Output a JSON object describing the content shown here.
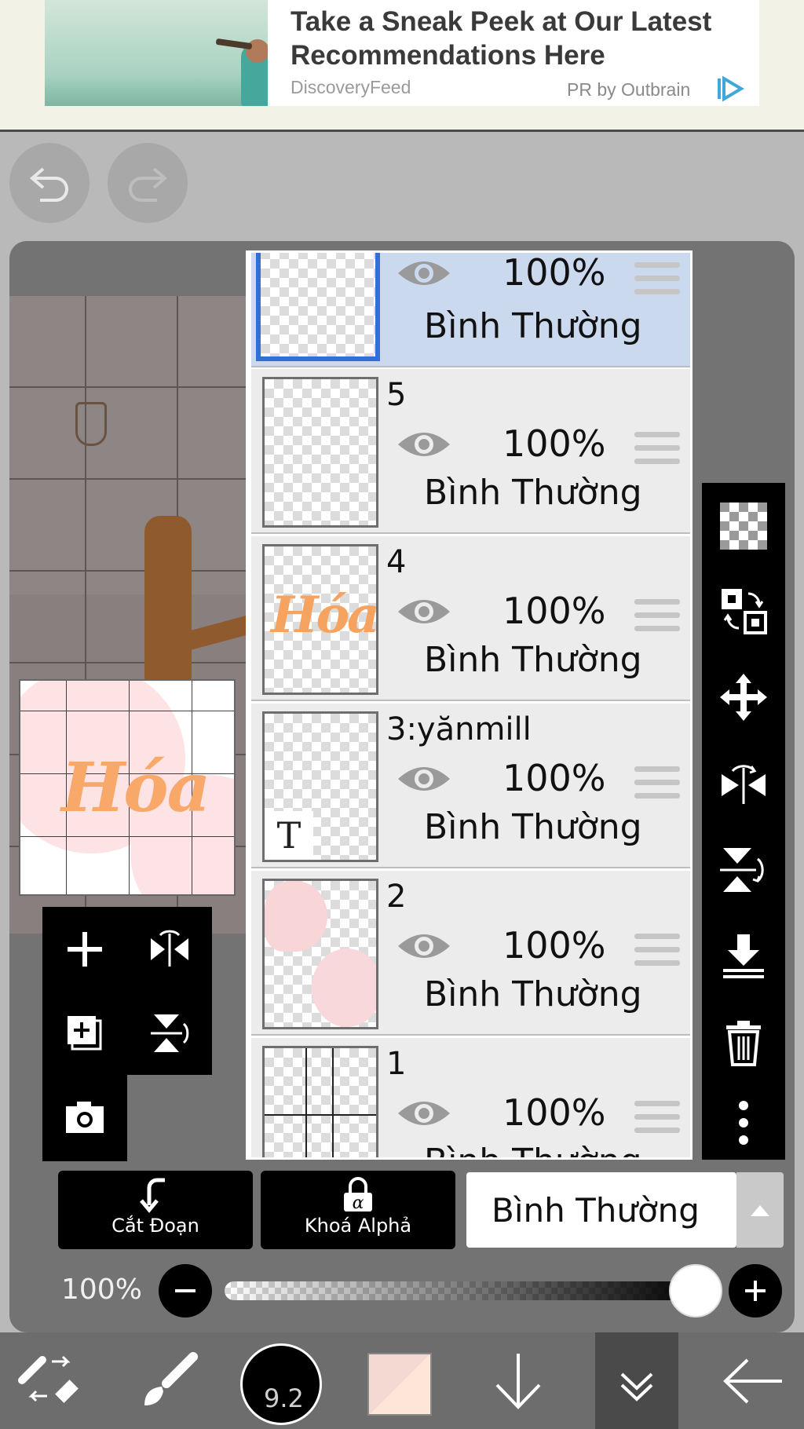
{
  "ad": {
    "title": "Take a Sneak Peek at Our Latest Recommendations Here",
    "source": "DiscoveryFeed",
    "pr": "PR by Outbrain"
  },
  "layers": [
    {
      "name": "",
      "opacity": "100%",
      "blend": "Bình Thường",
      "selected": true
    },
    {
      "name": "5",
      "opacity": "100%",
      "blend": "Bình Thường"
    },
    {
      "name": "4",
      "opacity": "100%",
      "blend": "Bình Thường",
      "thumb_text": "Hóa"
    },
    {
      "name": "3:yănmill",
      "opacity": "100%",
      "blend": "Bình Thường",
      "badge": "T"
    },
    {
      "name": "2",
      "opacity": "100%",
      "blend": "Bình Thường"
    },
    {
      "name": "1",
      "opacity": "100%",
      "blend": "Bình Thường"
    }
  ],
  "thumbnail": {
    "word": "Hóa"
  },
  "controls": {
    "clipping_label": "Cắt Đoạn",
    "alpha_lock_label": "Khoá Alphả",
    "blend_mode": "Bình Thường",
    "opacity_label": "100%",
    "opacity_value": 100
  },
  "bottom": {
    "brush_size": "9.2",
    "color": "#fde6d7"
  },
  "icons": [
    "undo-icon",
    "redo-icon",
    "checker-icon",
    "swap-layer-icon",
    "move-icon",
    "flip-horizontal-icon",
    "flip-vertical-icon",
    "merge-down-icon",
    "trash-icon",
    "more-icon",
    "add-layer-icon",
    "duplicate-layer-icon",
    "camera-icon"
  ]
}
